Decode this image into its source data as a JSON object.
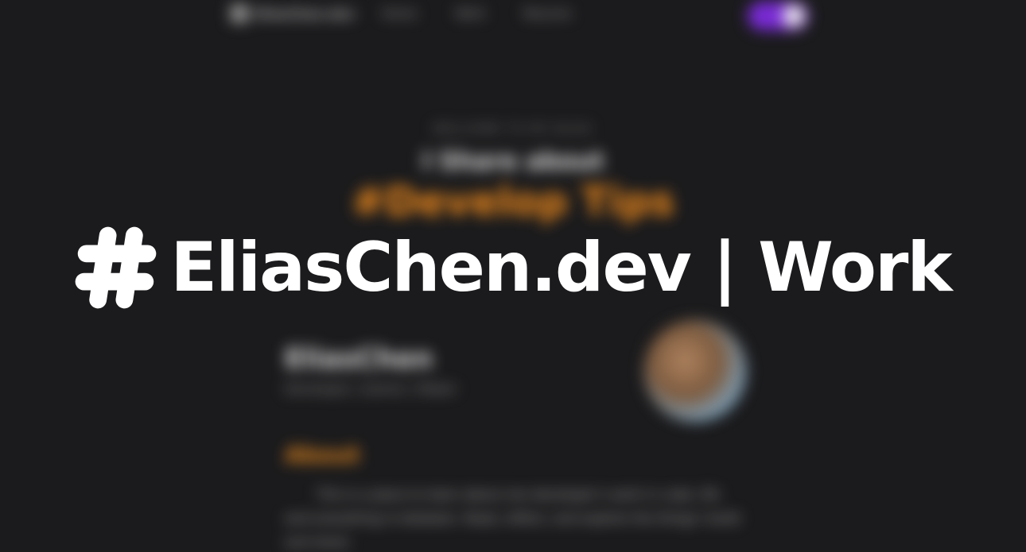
{
  "title": {
    "text": "EliasChen.dev | Work",
    "icon": "hash-icon"
  },
  "nav": {
    "logo_text": "EliasChen.dev",
    "links": [
      "Home",
      "Work",
      "Resume"
    ],
    "toggle_icon": "theme-toggle"
  },
  "hero": {
    "eyebrow": "WELCOME TO MY BLOG",
    "line": "I Share about",
    "topic": "#Develop Tips"
  },
  "profile": {
    "name": "EliasChen",
    "role": "Developer | Gamer | Maker"
  },
  "about": {
    "heading": "About",
    "text": "This is a place to learn about one developer’s work in code, life and everything in between. Read, reflect, and explore the things I build and share."
  },
  "colors": {
    "background": "#1b1b1d",
    "accent_orange": "#f08a1c",
    "toggle_purple": "#7a2bd6",
    "title_white": "#ffffff"
  }
}
